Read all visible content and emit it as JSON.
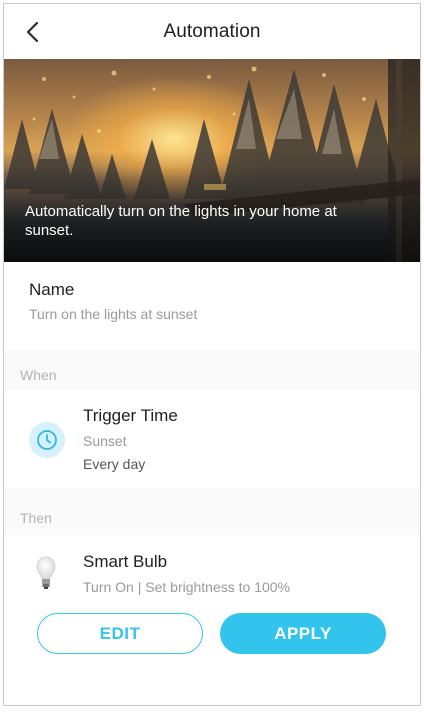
{
  "header": {
    "title": "Automation",
    "back_icon": "chevron-left-icon"
  },
  "hero": {
    "caption": "Automatically turn on the lights in your home at sunset."
  },
  "name_section": {
    "label": "Name",
    "value": "Turn on the lights at sunset"
  },
  "when": {
    "section_label": "When",
    "trigger": {
      "icon": "clock-icon",
      "title": "Trigger Time",
      "event": "Sunset",
      "repeat": "Every day"
    }
  },
  "then": {
    "section_label": "Then",
    "action": {
      "icon": "bulb-icon",
      "device": "Smart Bulb",
      "detail": "Turn On | Set brightness to 100%"
    }
  },
  "buttons": {
    "edit_label": "EDIT",
    "apply_label": "APPLY"
  },
  "colors": {
    "accent": "#33c4ee",
    "clock_bg": "#d6f1fb",
    "section_bg": "#fafafa"
  }
}
